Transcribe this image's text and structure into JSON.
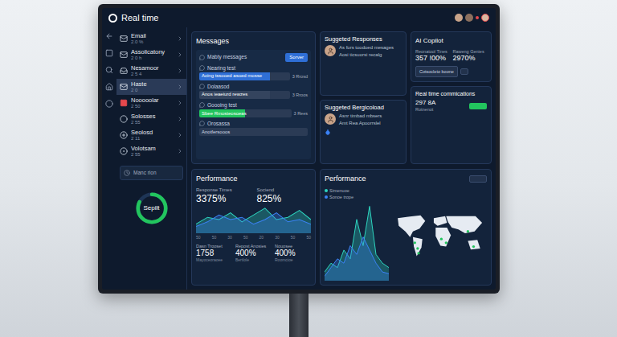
{
  "window": {
    "title": "Real time"
  },
  "sidebar": {
    "items": [
      {
        "label": "Email",
        "sub": "2.0 %",
        "selected": false,
        "color": "#cbd5e1"
      },
      {
        "label": "Assolicatony",
        "sub": "2 0 h",
        "selected": false,
        "color": "#cbd5e1"
      },
      {
        "label": "Nesamoor",
        "sub": "2 5 4",
        "selected": false,
        "color": "#cbd5e1"
      },
      {
        "label": "Haste",
        "sub": "2 0",
        "selected": true,
        "color": "#e2e8f0"
      },
      {
        "label": "Nooooolar",
        "sub": "2 50",
        "selected": false,
        "color": "#e5484d"
      },
      {
        "label": "Solosses",
        "sub": "2 55",
        "selected": false,
        "color": "#cbd5e1"
      },
      {
        "label": "Seolosd",
        "sub": "2 11",
        "selected": false,
        "color": "#cbd5e1"
      },
      {
        "label": "Volotsam",
        "sub": "2 55",
        "selected": false,
        "color": "#cbd5e1"
      }
    ],
    "footer": "Manc rion",
    "donut": {
      "label": "Sepilt",
      "level": 0.82
    }
  },
  "messages": {
    "title": "Messages",
    "rows": [
      {
        "kind": "button",
        "label": "Mabty messages",
        "action": "Sorver"
      },
      {
        "kind": "bar",
        "label": "Nearing test",
        "bar": "Acing tssooed asoed mosse",
        "count": "3 Rrosd",
        "color": "#2f6fd6",
        "level": 0.78
      },
      {
        "kind": "bar",
        "label": "Dolaasod",
        "bar": "Anos ieaeiurd rewzes",
        "count": "3 Rroos",
        "color": "#34445e",
        "level": 0.78
      },
      {
        "kind": "bar",
        "label": "Goooing test",
        "bar": "Sbee Rmosteosoeas",
        "count": "3 Rees",
        "color": "#22c55e",
        "level": 0.5
      },
      {
        "kind": "field",
        "label": "Orosassa",
        "bar": "Anotfersooos"
      }
    ]
  },
  "suggestions": [
    {
      "title": "Suggeted Responses",
      "lines": [
        "As fors toodoed mesages",
        "Aosi ticsuorsi recalg"
      ]
    },
    {
      "title": "Suggeted Bergicoload",
      "lines": [
        "Asnr timbad mbsers",
        "Amt Rea Apoorrslel"
      ]
    }
  ],
  "copilot": {
    "title": "AI Copilot",
    "stats": [
      {
        "label": "Reonatool Tines",
        "value": "357 !00%"
      },
      {
        "label": "Raweng Genies",
        "value": "2970%"
      }
    ],
    "button": "Cotsocleto boone"
  },
  "realtime": {
    "title": "Real time commications",
    "value": "297 8A",
    "sub": "Rotnenot"
  },
  "performance_left": {
    "title": "Performance",
    "stats": [
      {
        "label": "Response Times",
        "value": "3375%"
      },
      {
        "label": "Sociend",
        "value": "825%"
      }
    ],
    "chart": {
      "ticks": [
        "50",
        "50",
        "30",
        "50",
        "20",
        "30",
        "50",
        "50"
      ],
      "series": [
        {
          "color": "#2dd4bf",
          "values": [
            20,
            35,
            30,
            45,
            25,
            40,
            55,
            30,
            35,
            50,
            30
          ]
        },
        {
          "color": "#3b82f6",
          "values": [
            15,
            25,
            40,
            30,
            35,
            20,
            30,
            45,
            25,
            30,
            20
          ]
        }
      ]
    },
    "bottom": [
      {
        "label": "Dasn Trooset",
        "value": "1758",
        "sub": "Mayoceoraoee"
      },
      {
        "label": "Repost Anosies",
        "value": "400%",
        "sub": "Bertlole"
      },
      {
        "label": "Nouosee",
        "value": "400%",
        "sub": "Roomcioe"
      }
    ]
  },
  "performance_right": {
    "title": "Performance",
    "chart": {
      "series": [
        {
          "name": "Simenuoe",
          "color": "#2dd4bf",
          "values": [
            10,
            20,
            15,
            35,
            25,
            70,
            40,
            85,
            30,
            20,
            15
          ]
        },
        {
          "name": "Sonoe trope",
          "color": "#3b82f6",
          "values": [
            5,
            15,
            25,
            20,
            40,
            30,
            50,
            35,
            20,
            10,
            8
          ]
        }
      ]
    }
  }
}
